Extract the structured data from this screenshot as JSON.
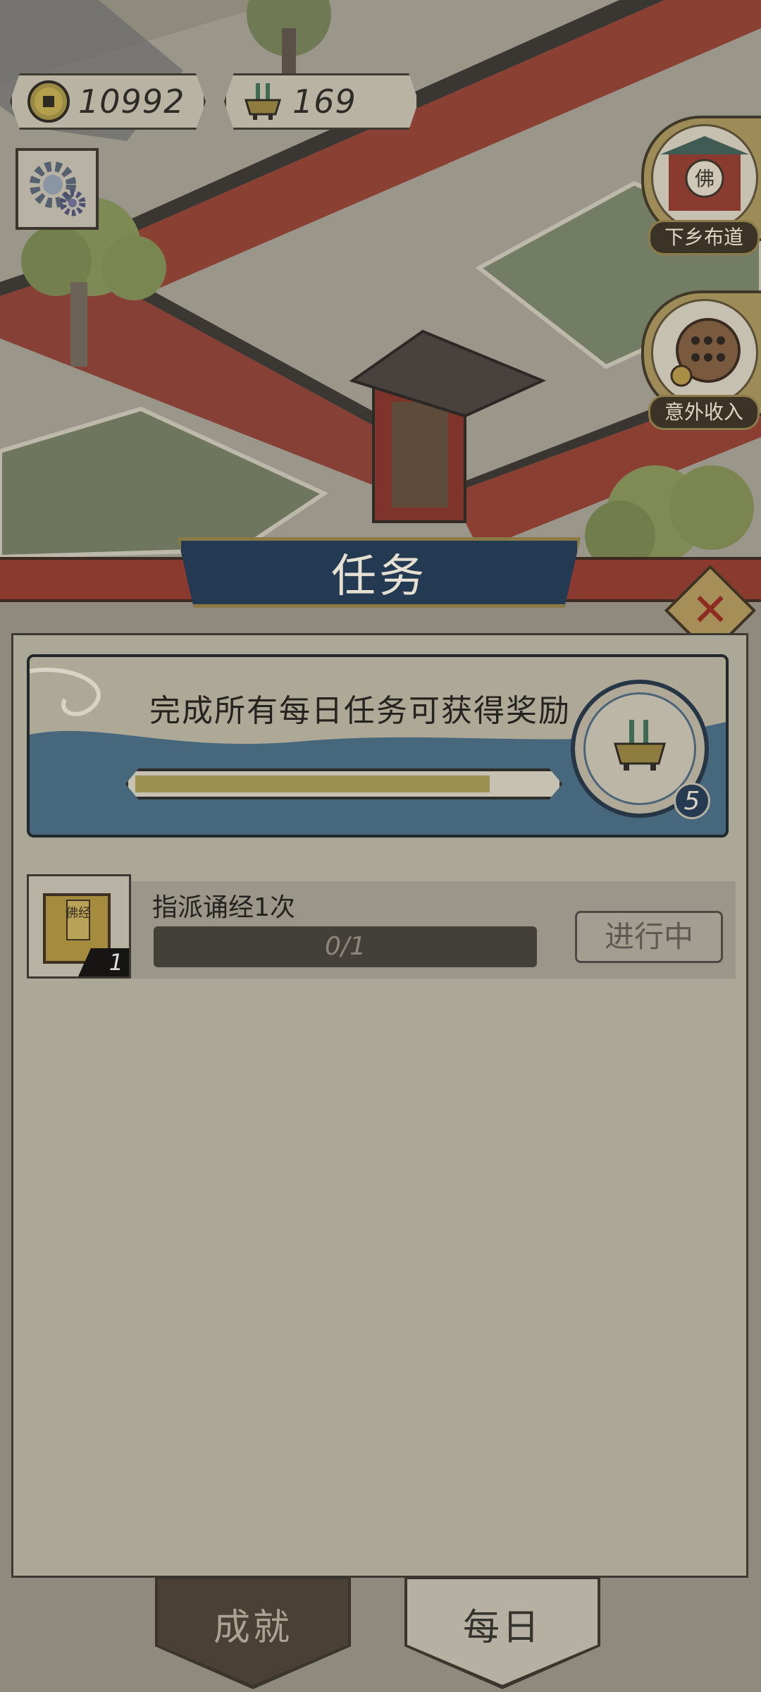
{
  "currencies": {
    "coins": "10992",
    "incense": "169"
  },
  "side_buttons": {
    "countryside_label": "下乡布道",
    "income_label": "意外收入"
  },
  "panel": {
    "title": "任务",
    "close_icon": "close-x-icon"
  },
  "daily_reward": {
    "title": "完成所有每日任务可获得奖励",
    "progress_fraction": 0.85,
    "reward_count": "5",
    "reward_icon": "incense-burner-icon"
  },
  "tasks": [
    {
      "name": "指派诵经1次",
      "progress": "0/1",
      "status": "进行中",
      "item_count": "1",
      "item_label": "佛经"
    }
  ],
  "tabs": {
    "achievements": "成就",
    "daily": "每日"
  },
  "colors": {
    "panel_title_bg": "#243a52",
    "gold": "#9b8f52",
    "wall_red": "#8b3a30"
  }
}
